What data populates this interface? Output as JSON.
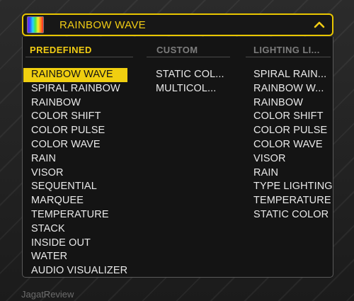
{
  "dropdown": {
    "selected": "RAINBOW WAVE",
    "swatch_colors": [
      "#7a1fff",
      "#2a5bff",
      "#27d3ff",
      "#46e64a",
      "#f5f02b",
      "#ff8a1e",
      "#ff2a2a"
    ],
    "chevron_icon": "chevron-up-icon"
  },
  "tabs": [
    {
      "label": "PREDEFINED",
      "active": true
    },
    {
      "label": "CUSTOM",
      "active": false
    },
    {
      "label": "LIGHTING LI...",
      "active": false
    }
  ],
  "columns": {
    "predefined": [
      "RAINBOW WAVE",
      "SPIRAL RAINBOW",
      "RAINBOW",
      "COLOR SHIFT",
      "COLOR PULSE",
      "COLOR WAVE",
      "RAIN",
      "VISOR",
      "SEQUENTIAL",
      "MARQUEE",
      "TEMPERATURE",
      "STACK",
      "INSIDE OUT",
      "WATER",
      "AUDIO VISUALIZER"
    ],
    "custom": [
      "STATIC COL...",
      "MULTICOL..."
    ],
    "lighting_link": [
      "SPIRAL RAIN...",
      "RAINBOW W...",
      "RAINBOW",
      "COLOR SHIFT",
      "COLOR PULSE",
      "COLOR WAVE",
      "VISOR",
      "RAIN",
      "TYPE LIGHTING",
      "TEMPERATURE",
      "STATIC COLOR"
    ]
  },
  "watermark": "JagatReview",
  "colors": {
    "accent": "#f1cc14",
    "panel_bg": "#141414",
    "text": "#e9e9e9",
    "inactive_tab": "#7d7d7d"
  }
}
